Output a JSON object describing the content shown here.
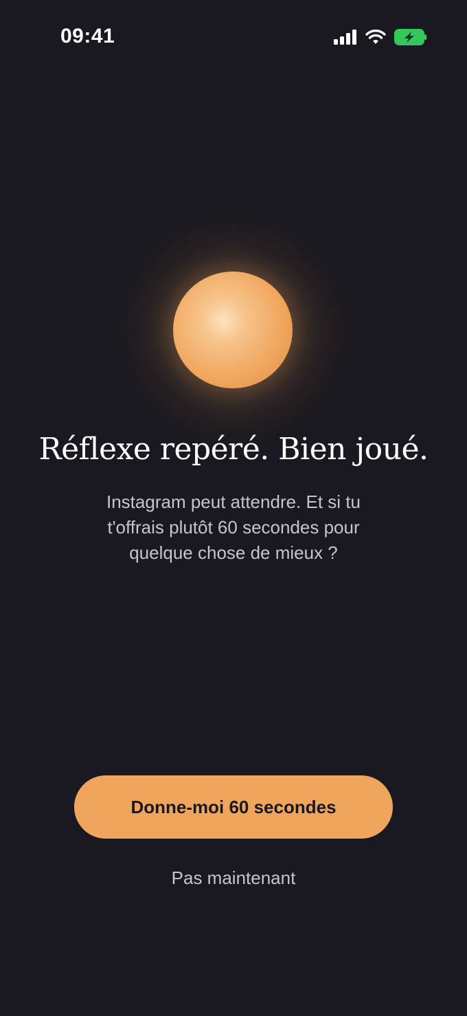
{
  "status_bar": {
    "time": "09:41",
    "icons": [
      "cellular-signal-icon",
      "wifi-icon",
      "battery-charging-icon"
    ],
    "battery_color": "#34c759"
  },
  "orb": {
    "color": "#f0a55c"
  },
  "content": {
    "headline": "Réflexe repéré. Bien joué.",
    "body_lines": [
      "Instagram peut attendre. Et si tu",
      "t'offrais plutôt 60 secondes pour",
      "quelque chose de mieux ?"
    ]
  },
  "actions": {
    "primary_label": "Donne-moi 60 secondes",
    "secondary_label": "Pas maintenant"
  },
  "colors": {
    "background": "#1a1820",
    "accent": "#f0a55c",
    "muted_text": "#c7c5cc"
  }
}
